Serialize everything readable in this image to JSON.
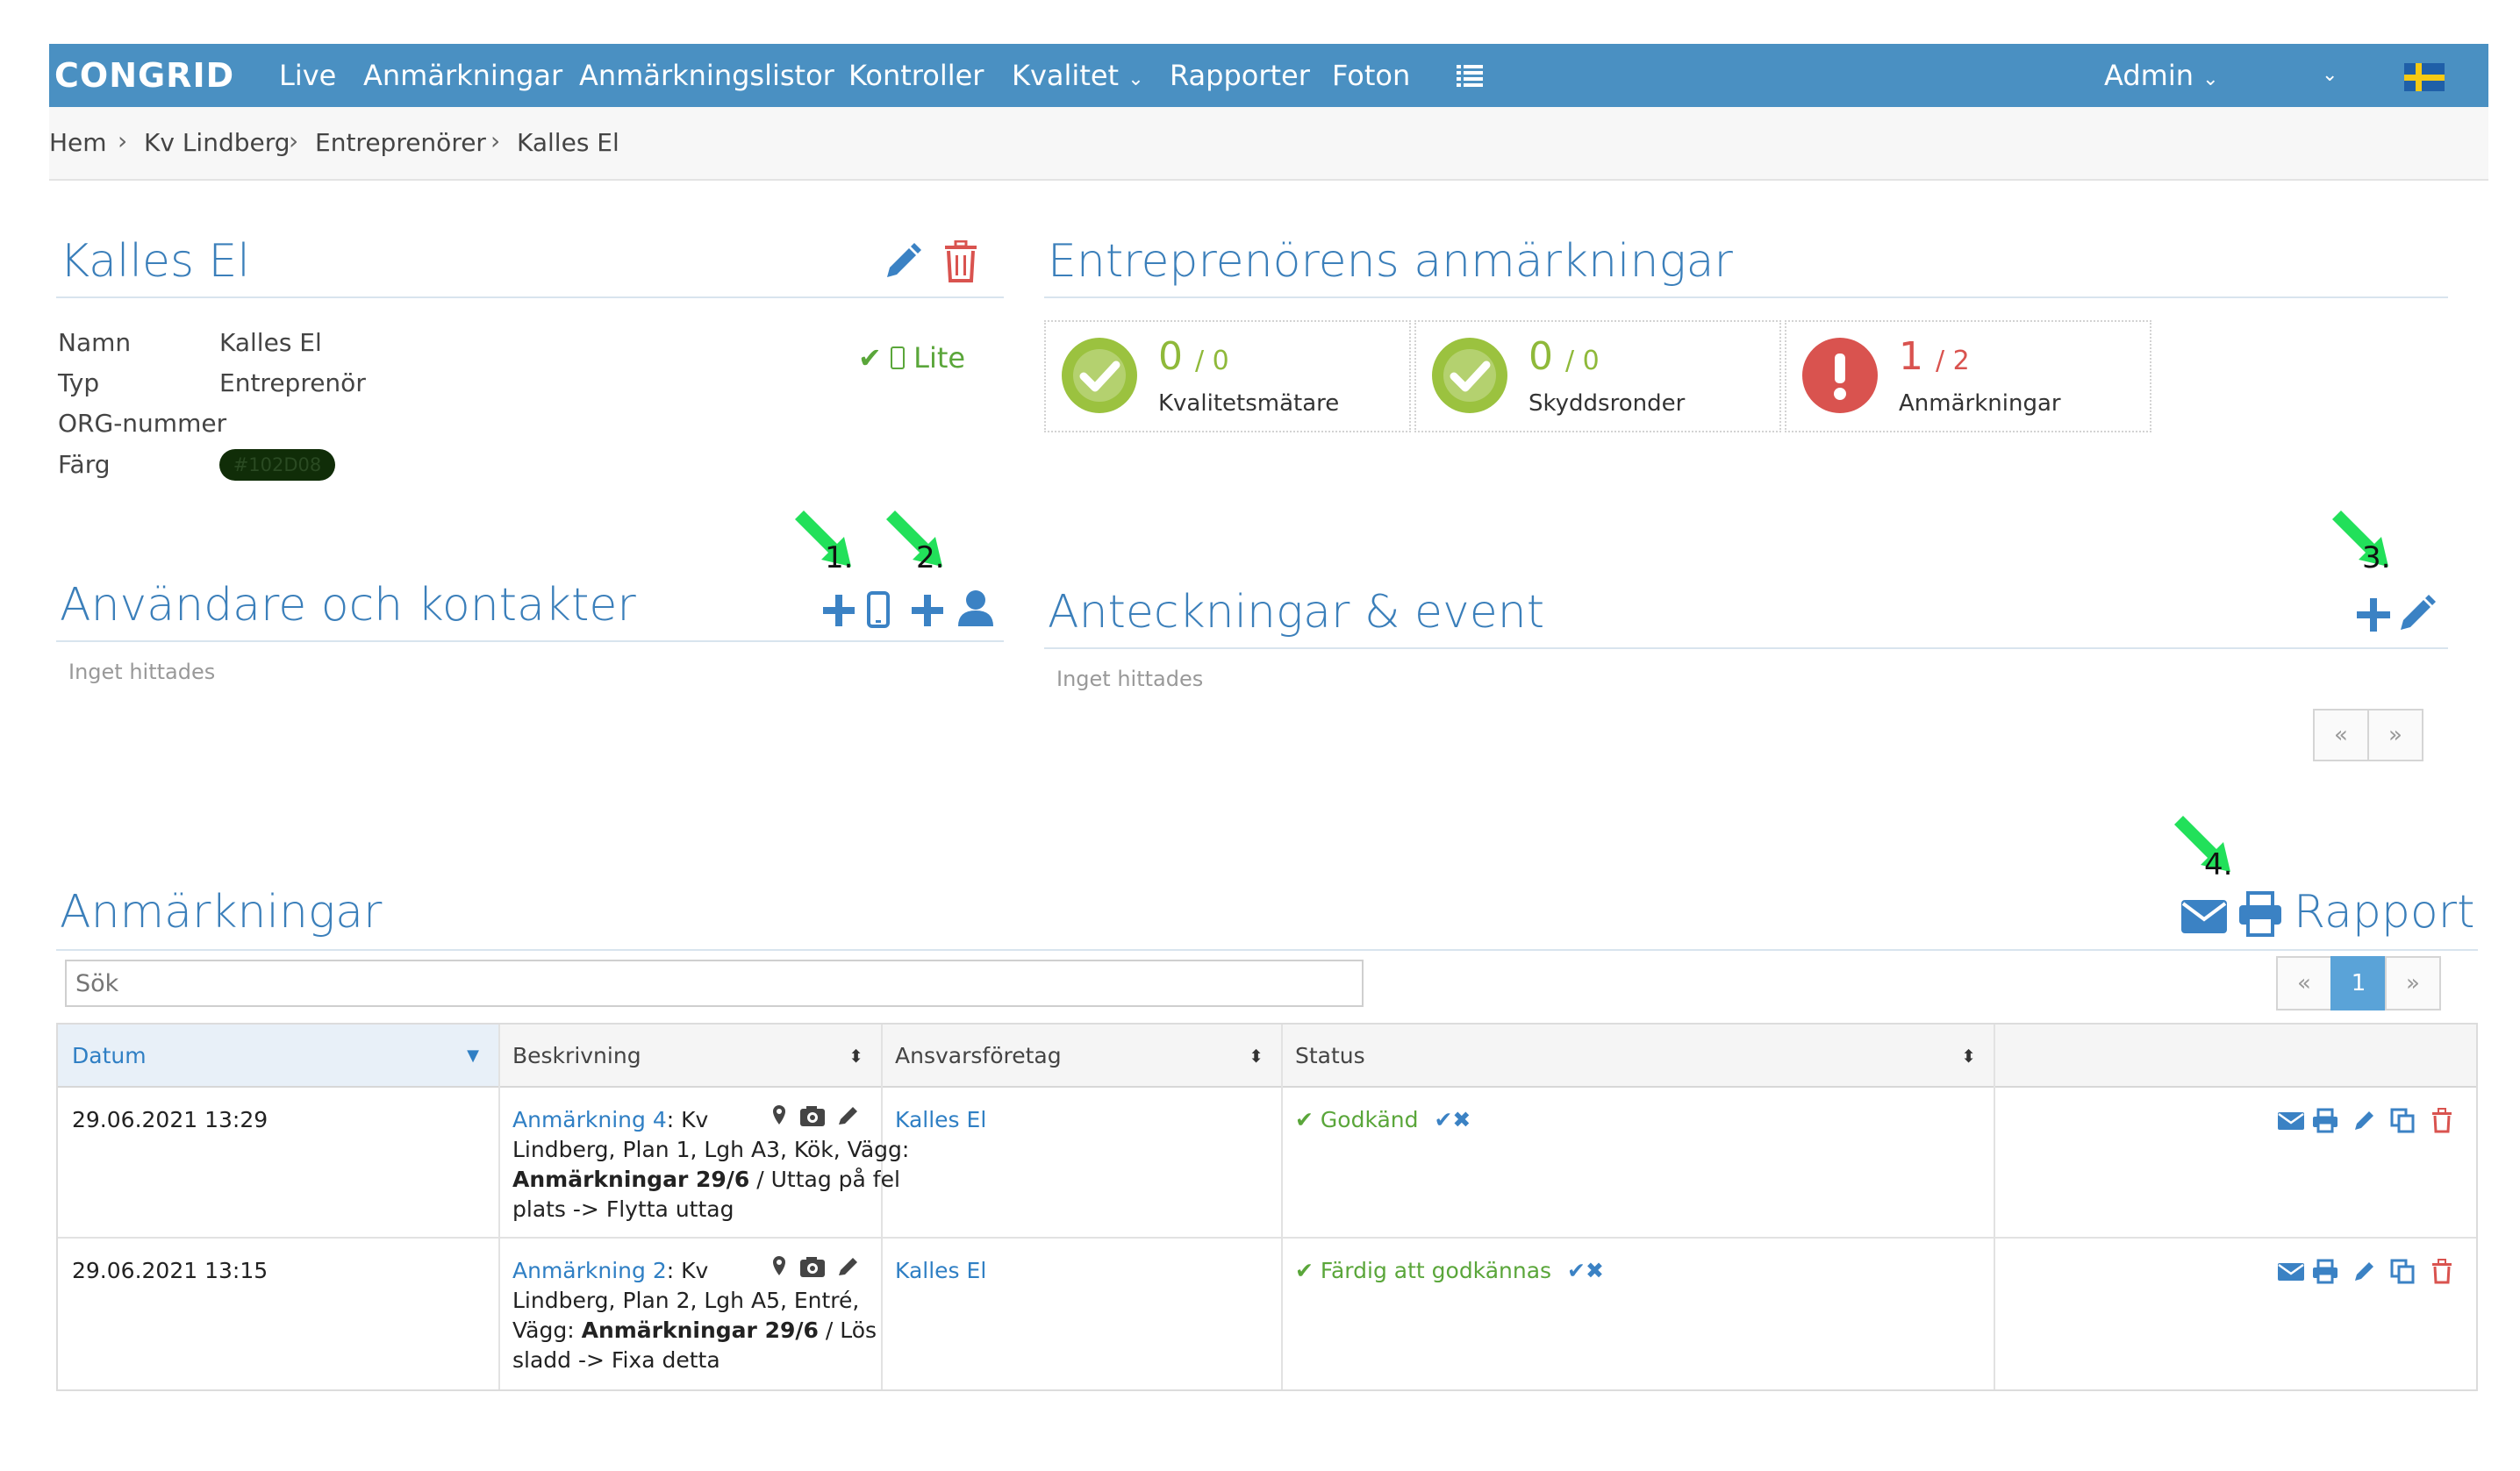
{
  "navbar": {
    "logo": "CONGRID",
    "items": [
      "Live",
      "Anmärkningar",
      "Anmärkningslistor",
      "Kontroller",
      "Kvalitet",
      "Rapporter",
      "Foton"
    ],
    "user": "Admin",
    "bg_color": "#4a90c2"
  },
  "breadcrumb": [
    "Hem",
    "Kv Lindberg",
    "Entreprenörer",
    "Kalles El"
  ],
  "contractor": {
    "title": "Kalles El",
    "fields": [
      {
        "label": "Namn",
        "value": "Kalles El"
      },
      {
        "label": "Typ",
        "value": "Entreprenör"
      },
      {
        "label": "ORG-nummer",
        "value": ""
      },
      {
        "label": "Färg",
        "value": "#102D08"
      }
    ],
    "license": "Lite",
    "color_swatch": "#102D08"
  },
  "remarks_summary": {
    "title": "Entreprenörens anmärkningar",
    "cards": [
      {
        "value": "0",
        "total": "/ 0",
        "label": "Kvalitetsmätare",
        "status": "ok"
      },
      {
        "value": "0",
        "total": "/ 0",
        "label": "Skyddsronder",
        "status": "ok"
      },
      {
        "value": "1",
        "total": "/ 2",
        "label": "Anmärkningar",
        "status": "alert"
      }
    ]
  },
  "users": {
    "title": "Användare och kontakter",
    "empty": "Inget hittades",
    "callouts": [
      "1.",
      "2."
    ]
  },
  "notes": {
    "title": "Anteckningar & event",
    "empty": "Inget hittades",
    "callout": "3.",
    "pager_prev": "«",
    "pager_next": "»"
  },
  "remarks": {
    "title": "Anmärkningar",
    "report_label": "Rapport",
    "callout": "4.",
    "search_placeholder": "Sök",
    "pager": {
      "prev": "«",
      "current": "1",
      "next": "»"
    },
    "columns": [
      "Datum",
      "Beskrivning",
      "Ansvarsföretag",
      "Status"
    ],
    "rows": [
      {
        "date": "29.06.2021 13:29",
        "link": "Anmärkning 4",
        "line1": ": Kv",
        "line2": "Lindberg, Plan 1, Lgh A3, Kök, Vägg:",
        "bold": "Anmärkningar 29/6",
        "line3_rest": " / Uttag på fel",
        "line4": "plats -> Flytta uttag",
        "company": "Kalles El",
        "status": "Godkänd"
      },
      {
        "date": "29.06.2021 13:15",
        "link": "Anmärkning 2",
        "line1": ": Kv",
        "line2": "Lindberg, Plan 2, Lgh A5, Entré,",
        "line3_pre": "Vägg: ",
        "bold": "Anmärkningar 29/6",
        "line3_rest": " / Lös",
        "line4": "sladd -> Fixa detta",
        "company": "Kalles El",
        "status": "Färdig att godkännas"
      }
    ]
  },
  "colors": {
    "accent": "#3b7fba",
    "success": "#5aa63a",
    "danger": "#d9534f",
    "callout_arrow": "#22e05a"
  }
}
